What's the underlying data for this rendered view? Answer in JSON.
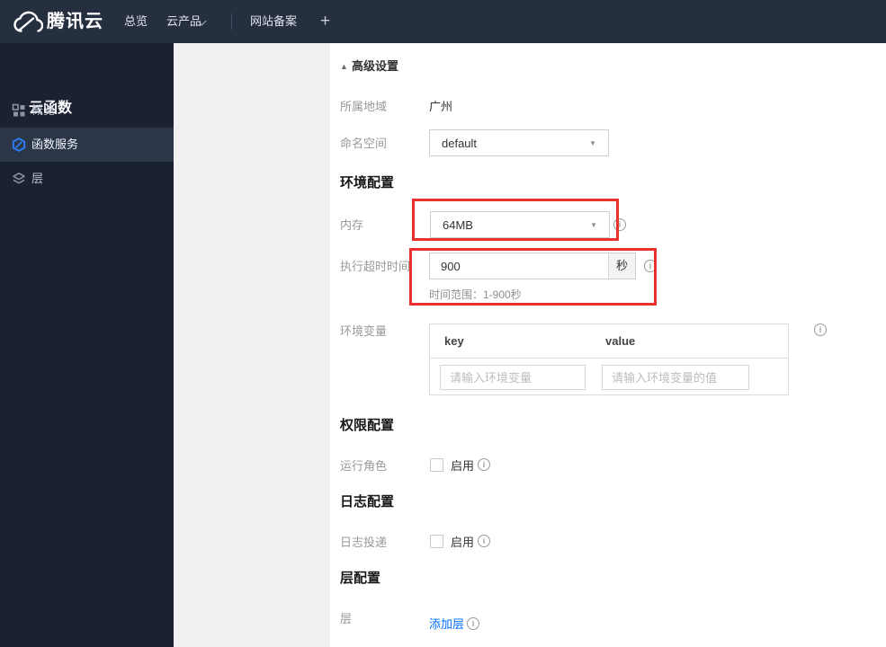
{
  "colors": {
    "highlight_red": "#e8302d",
    "accent_blue": "#006eff",
    "navbar_bg": "#262f40",
    "sidebar_bg": "#1a2231"
  },
  "icons": {
    "collapse_up": "▲",
    "select_caret": "▼",
    "info": "i",
    "plus": "+"
  },
  "navbar": {
    "brand": "腾讯云",
    "items": [
      {
        "label": "总览"
      },
      {
        "label": "云产品"
      },
      {
        "label": "网站备案"
      }
    ]
  },
  "sidebar": {
    "title": "云函数",
    "items": [
      {
        "label": "概览",
        "icon": "grid-icon",
        "selected": false
      },
      {
        "label": "函数服务",
        "icon": "function-icon",
        "selected": true
      },
      {
        "label": "层",
        "icon": "layers-icon",
        "selected": false
      }
    ]
  },
  "main": {
    "advanced": {
      "label": "高级设置"
    },
    "region": {
      "label": "所属地域",
      "value": "广州"
    },
    "namespace": {
      "label": "命名空间",
      "value": "default"
    },
    "env_section": {
      "title": "环境配置"
    },
    "memory": {
      "label": "内存",
      "value": "64MB"
    },
    "timeout": {
      "label": "执行超时时间",
      "value": "900",
      "unit": "秒",
      "hint": "时间范围：1-900秒"
    },
    "env_vars": {
      "label": "环境变量",
      "key_header": "key",
      "value_header": "value",
      "key_placeholder": "请输入环境变量",
      "value_placeholder": "请输入环境变量的值"
    },
    "perm_section": {
      "title": "权限配置"
    },
    "run_role": {
      "label": "运行角色",
      "checkbox_label": "启用"
    },
    "log_section": {
      "title": "日志配置"
    },
    "log_delivery": {
      "label": "日志投递",
      "checkbox_label": "启用"
    },
    "layer_section": {
      "title": "层配置"
    },
    "layer": {
      "label": "层",
      "add_link": "添加层"
    }
  }
}
